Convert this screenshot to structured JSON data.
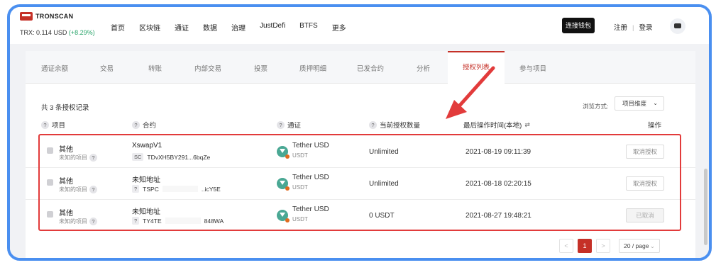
{
  "header": {
    "logo_text": "TRONSCAN",
    "price_label": "TRX: 0.114 USD",
    "price_change": "(+8.29%)",
    "nav": [
      "首页",
      "区块链",
      "通证",
      "数据",
      "治理",
      "JustDefi",
      "BTFS",
      "更多"
    ],
    "connect_wallet": "连接钱包",
    "register": "注册",
    "separator": "|",
    "login": "登录"
  },
  "tabs": [
    "通证余额",
    "交易",
    "转账",
    "内部交易",
    "投票",
    "质押明细",
    "已发合约",
    "分析",
    "授权列表",
    "参与项目"
  ],
  "active_tab": "授权列表",
  "summary": {
    "count_text": "共 3 条授权记录",
    "view_label": "浏览方式:",
    "view_value": "项目维度"
  },
  "columns": {
    "project": "项目",
    "contract": "合约",
    "token": "通证",
    "amount": "当前授权数量",
    "time": "最后操作时间(本地)",
    "action": "操作"
  },
  "rows": [
    {
      "project": "其他",
      "project_sub": "未知的项目",
      "contract_name": "XswapV1",
      "contract_badge": "SC",
      "contract_addr": "TDvXH5BY291...6bqZe",
      "token_name": "Tether USD",
      "token_symbol": "USDT",
      "amount": "Unlimited",
      "time": "2021-08-19 09:11:39",
      "action": "取消授权"
    },
    {
      "project": "其他",
      "project_sub": "未知的项目",
      "contract_name": "未知地址",
      "contract_badge": "?",
      "contract_addr": "TSPC",
      "contract_addr_tail": "..icY5E",
      "token_name": "Tether USD",
      "token_symbol": "USDT",
      "amount": "Unlimited",
      "time": "2021-08-18 02:20:15",
      "action": "取消授权"
    },
    {
      "project": "其他",
      "project_sub": "未知的项目",
      "contract_name": "未知地址",
      "contract_badge": "?",
      "contract_addr": "TY4TE",
      "contract_addr_tail": "848WA",
      "token_name": "Tether USD",
      "token_symbol": "USDT",
      "amount": "0 USDT",
      "time": "2021-08-27 19:48:21",
      "action": "已取消"
    }
  ],
  "pagination": {
    "prev": "<",
    "current": "1",
    "next": ">",
    "page_size": "20 / page"
  },
  "colors": {
    "accent": "#c53027",
    "highlight_box": "#e23b3b",
    "frame": "#4a8ff0"
  }
}
